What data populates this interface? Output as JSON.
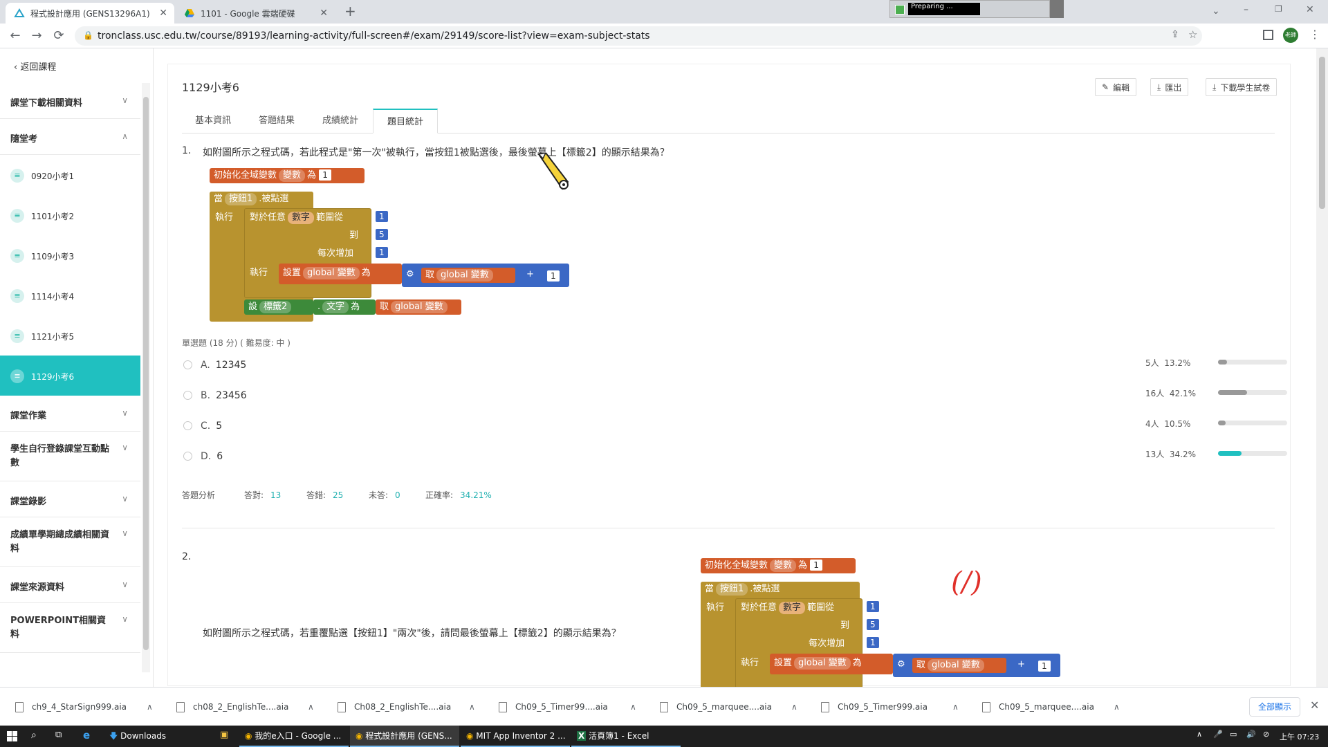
{
  "browser": {
    "tabs": [
      {
        "title": "程式設計應用 (GENS13296A1)",
        "active": true
      },
      {
        "title": "1101 - Google 雲端硬碟",
        "active": false
      }
    ],
    "new_tab": "+",
    "url": "tronclass.usc.edu.tw/course/89193/learning-activity/full-screen#/exam/29149/score-list?view=exam-subject-stats",
    "preparing": "Preparing ...",
    "avatar": "老師"
  },
  "sidebar": {
    "back": "返回課程",
    "sections": {
      "download": "課堂下載相關資料",
      "quiz": "隨堂考",
      "homework": "課堂作業",
      "interaction": "學生自行登錄課堂互動點數",
      "recording": "課堂錄影",
      "grades": "成績單學期總成績相關資料",
      "source": "課堂來源資料",
      "ppt": "POWERPOINT相關資料"
    },
    "quizzes": [
      {
        "label": "0920小考1"
      },
      {
        "label": "1101小考2"
      },
      {
        "label": "1109小考3"
      },
      {
        "label": "1114小考4"
      },
      {
        "label": "1121小考5"
      },
      {
        "label": "1129小考6"
      }
    ]
  },
  "main": {
    "title": "1129小考6",
    "buttons": {
      "edit": "編輯",
      "export": "匯出",
      "download": "下載學生試卷"
    },
    "tabs": [
      "基本資訊",
      "答題結果",
      "成績統計",
      "題目統計"
    ],
    "q1": {
      "number": "1.",
      "text": "如附圖所示之程式碼，若此程式是\"第一次\"被執行，當按鈕1被點選後，最後螢幕上【標籤2】的顯示結果為？",
      "meta": "單選題 (18 分) ( 難易度: 中 )",
      "options": [
        {
          "letter": "A.",
          "text": "12345",
          "count": "5人",
          "pct": "13.2%",
          "value": 0.132
        },
        {
          "letter": "B.",
          "text": "23456",
          "count": "16人",
          "pct": "42.1%",
          "value": 0.421
        },
        {
          "letter": "C.",
          "text": "5",
          "count": "4人",
          "pct": "10.5%",
          "value": 0.105
        },
        {
          "letter": "D.",
          "text": "6",
          "count": "13人",
          "pct": "34.2%",
          "value": 0.342
        }
      ],
      "analysis": {
        "label": "答題分析",
        "correct_label": "答對:",
        "correct": "13",
        "wrong_label": "答錯:",
        "wrong": "25",
        "none_label": "未答:",
        "none": "0",
        "rate_label": "正確率:",
        "rate": "34.21%"
      }
    },
    "q2": {
      "number": "2.",
      "text": "如附圖所示之程式碼，若重覆點選【按鈕1】\"兩次\"後，請問最後螢幕上【標籤2】的顯示結果為？",
      "annotation": "(/)"
    },
    "blocks": {
      "init": "初始化全域變數",
      "var": "變數",
      "as": "為",
      "one": "1",
      "when": "當",
      "button": "按鈕1",
      "clicked": ".被點選",
      "do": "執行",
      "foreach": "對於任意",
      "number": "數字",
      "from": "範圍從",
      "to": "到",
      "five": "5",
      "step": "每次增加",
      "set": "設置",
      "gvar": "global 變數",
      "get": "取",
      "plus": "+",
      "setlbl": "設",
      "label2": "標籤2",
      "dot": ".",
      "text": "文字"
    }
  },
  "downloads": [
    "ch9_4_StarSign999.aia",
    "ch08_2_EnglishTe....aia",
    "Ch08_2_EnglishTe....aia",
    "Ch09_5_Timer99....aia",
    "Ch09_5_marquee....aia",
    "Ch09_5_Timer999.aia",
    "Ch09_5_marquee....aia"
  ],
  "downloads_showall": "全部顯示",
  "taskbar": {
    "items": [
      "Downloads",
      "我的e入口 - Google ...",
      "程式設計應用 (GENS...",
      "MIT App Inventor 2 ...",
      "活頁簿1 - Excel"
    ],
    "time": "上午 07:23"
  },
  "colors": {
    "accent": "#20c0c0",
    "block_orange": "#d35c2a",
    "block_olive": "#b8932f",
    "block_green": "#3d8a3a",
    "block_blue": "#3b68c5"
  }
}
